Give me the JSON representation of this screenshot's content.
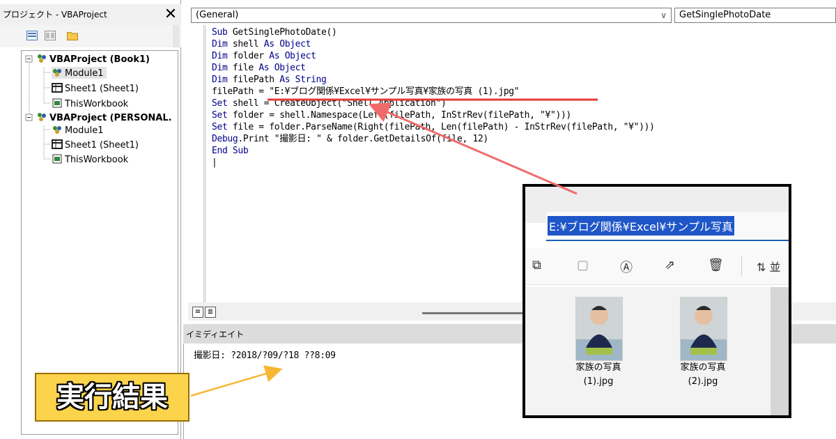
{
  "project_pane": {
    "title": "プロジェクト - VBAProject",
    "close_glyph": "✕",
    "tree": [
      {
        "label": "VBAProject (Book1)",
        "bold": true,
        "icon": "vbaproject-icon"
      },
      {
        "label": "Module1",
        "icon": "module-icon",
        "selected": true
      },
      {
        "label": "Sheet1 (Sheet1)",
        "icon": "sheet-icon"
      },
      {
        "label": "ThisWorkbook",
        "icon": "workbook-icon"
      },
      {
        "label": "VBAProject (PERSONAL.",
        "bold": true,
        "icon": "vbaproject-icon"
      },
      {
        "label": "Module1",
        "icon": "module-icon"
      },
      {
        "label": "Sheet1 (Sheet1)",
        "icon": "sheet-icon"
      },
      {
        "label": "ThisWorkbook",
        "icon": "workbook-icon"
      }
    ]
  },
  "code_window": {
    "object_combo": "(General)",
    "procedure_combo": "GetSinglePhotoDate",
    "lines": [
      "Sub GetSinglePhotoDate()",
      "Dim shell As Object",
      "Dim folder As Object",
      "Dim file As Object",
      "Dim filePath As String",
      "filePath = \"E:¥ブログ関係¥Excel¥サンプル写真¥家族の写真 (1).jpg\"",
      "Set shell = CreateObject(\"Shell.Application\")",
      "Set folder = shell.Namespace(Left(filePath, InStrRev(filePath, \"¥\")))",
      "Set file = folder.ParseName(Right(filePath, Len(filePath) - InStrRev(filePath, \"¥\")))",
      "Debug.Print \"撮影日: \" & folder.GetDetailsOf(file, 12)",
      "End Sub",
      "|"
    ]
  },
  "immediate_window": {
    "title": "イミディエイト",
    "output": "撮影日: ?2018/?09/?18 ??8:09"
  },
  "annotation": {
    "result_label": "実行結果",
    "underline_color": "#e53935",
    "arrow_red_color": "#ef6b6b",
    "arrow_yellow_color": "#f7b733"
  },
  "explorer_inset": {
    "address_path": "E:¥ブログ関係¥Excel¥サンプル写真",
    "sort_label": "並",
    "photos": [
      {
        "name_line1": "家族の写真",
        "name_line2": "(1).jpg"
      },
      {
        "name_line1": "家族の写真",
        "name_line2": "(2).jpg"
      }
    ]
  }
}
